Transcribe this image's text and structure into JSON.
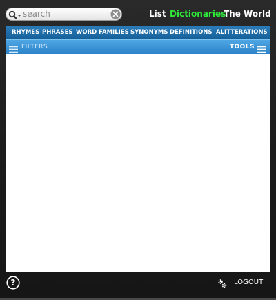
{
  "search": {
    "placeholder": "search",
    "value": ""
  },
  "nav": {
    "list": "List",
    "dictionaries": "Dictionaries",
    "world": "The World",
    "active_color": "#2ee83a"
  },
  "tabs": [
    {
      "label": "RHYMES",
      "active": false
    },
    {
      "label": "PHRASES",
      "active": false
    },
    {
      "label": "WORD FAMILIES",
      "active": false
    },
    {
      "label": "SYNONYMS",
      "active": true
    },
    {
      "label": "DEFINITIONS",
      "active": false
    },
    {
      "label": "ALITTERATIONS",
      "active": false
    }
  ],
  "filterbar": {
    "filters_label": "FILTERS",
    "tools_label": "TOOLS",
    "filters_icon": "menu-icon",
    "tools_icon": "menu-icon"
  },
  "footer": {
    "help_icon": "help-icon",
    "gears_icon": "gears-icon",
    "logout_label": "LOGOUT"
  },
  "colors": {
    "tab_bar": "#1f6ea9",
    "filter_bar": "#3a95d8",
    "frame": "#1f1f1f",
    "content": "#ffffff"
  }
}
